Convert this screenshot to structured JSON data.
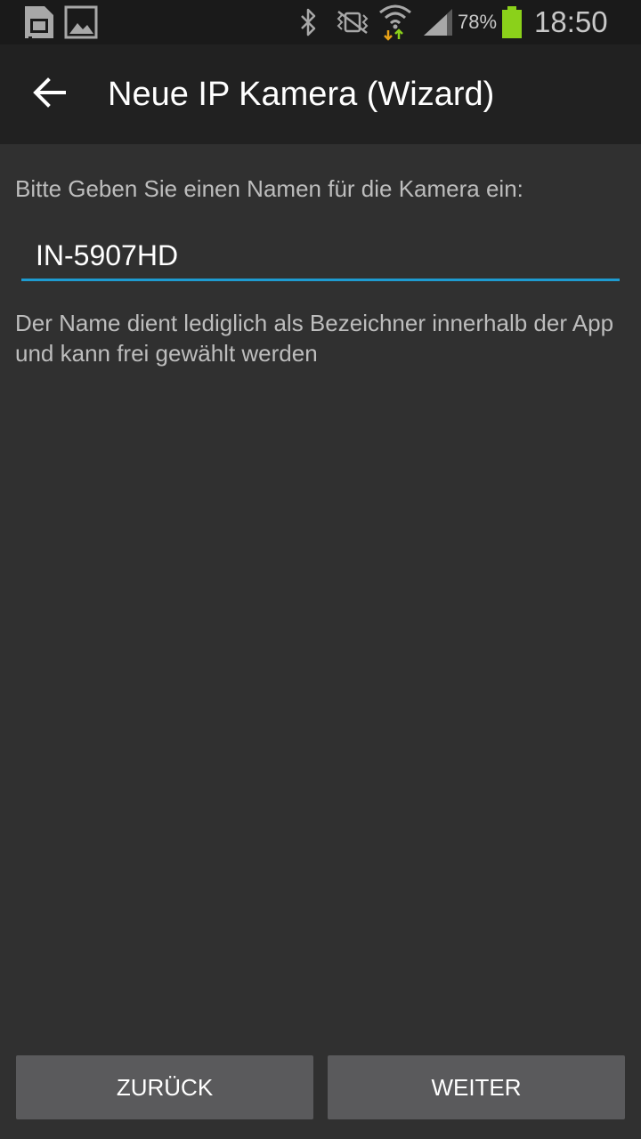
{
  "status_bar": {
    "icons": [
      "sim-card-icon",
      "image-icon",
      "bluetooth-icon",
      "vibrate-icon",
      "wifi-data-icon",
      "signal-icon",
      "battery-icon"
    ],
    "battery": "78%",
    "time": "18:50"
  },
  "app_bar": {
    "back_icon": "arrow-back-icon",
    "title": "Neue IP Kamera (Wizard)"
  },
  "form": {
    "prompt": "Bitte Geben Sie einen Namen für die Kamera ein:",
    "name_value": "IN-5907HD",
    "help": "Der Name dient lediglich als Bezeichner innerhalb der App und kann frei gewählt werden"
  },
  "buttons": {
    "back_label": "ZURÜCK",
    "next_label": "WEITER"
  },
  "colors": {
    "accent": "#1e9bd0",
    "battery": "#8bd11a",
    "background": "#303030",
    "app_bar": "#212121",
    "button": "#5a5a5c"
  }
}
